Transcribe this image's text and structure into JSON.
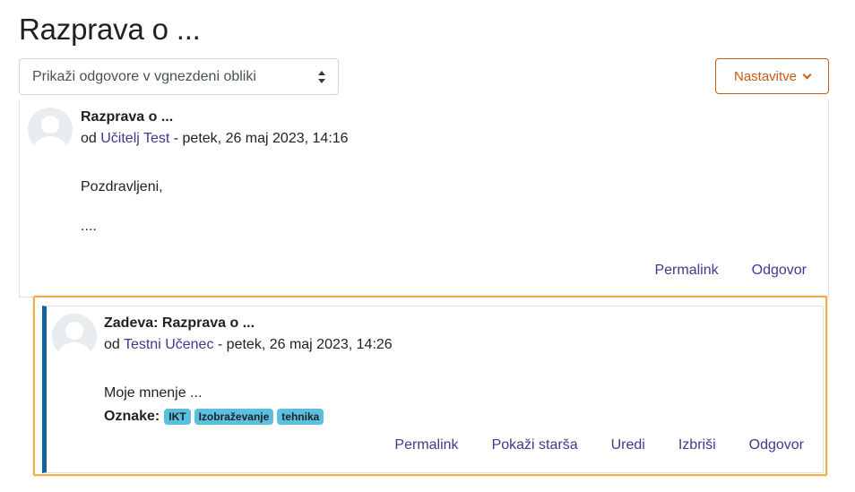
{
  "page": {
    "title": "Razprava o ..."
  },
  "display_mode": {
    "selected": "Prikaži odgovore v vgnezdeni obliki"
  },
  "settings": {
    "label": "Nastavitve"
  },
  "posts": [
    {
      "subject": "Razprava o ...",
      "by": "od",
      "author": "Učitelj Test",
      "date": " - petek, 26 maj 2023, 14:16",
      "paragraphs": [
        "Pozdravljeni,",
        "...."
      ],
      "actions": [
        "Permalink",
        "Odgovor"
      ]
    },
    {
      "subject": "Zadeva: Razprava o ...",
      "by": "od",
      "author": "Testni Učenec",
      "date": " - petek, 26 maj 2023, 14:26",
      "paragraphs": [
        "Moje mnenje ..."
      ],
      "tags_label": "Oznake:",
      "tags": [
        "IKT",
        "Izobraževanje",
        "tehnika"
      ],
      "actions": [
        "Permalink",
        "Pokaži starša",
        "Uredi",
        "Izbriši",
        "Odgovor"
      ]
    }
  ],
  "colors": {
    "accent": "#c65b12",
    "link": "#3e3a8c",
    "tag": "#5bc0de",
    "reply_border": "#10639d",
    "focus": "#f0ad4e"
  }
}
